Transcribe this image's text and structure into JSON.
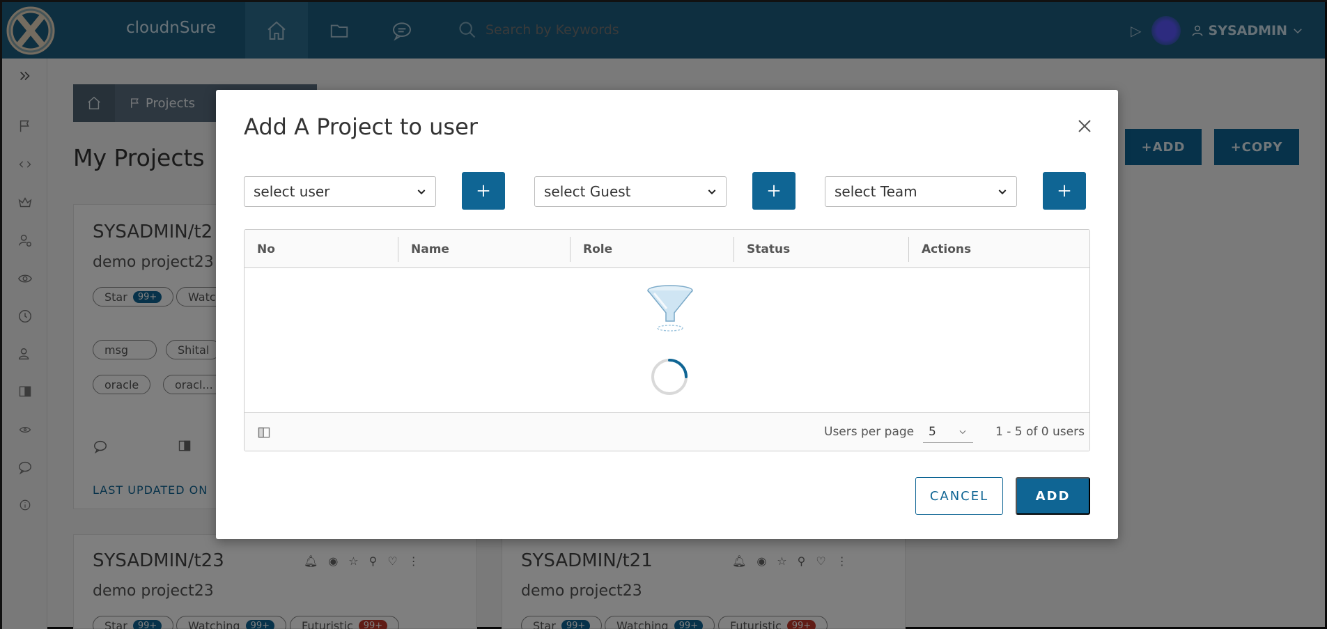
{
  "header": {
    "brand": "cloudnSure",
    "search_placeholder": "Search by Keywords",
    "user_label": "SYSADMIN",
    "icons": [
      "logo-icon",
      "home-icon",
      "folder-icon",
      "chat-icon",
      "search-icon",
      "play-icon",
      "user-icon",
      "chevron-down-icon"
    ]
  },
  "sidebar": {
    "icons": [
      "expand-icon",
      "flag-icon",
      "code-icon",
      "crown-icon",
      "user-settings-icon",
      "eye-icon",
      "clock-icon",
      "user-group-icon",
      "columns-icon",
      "eye-small-icon",
      "chat-icon",
      "info-icon"
    ]
  },
  "breadcrumb": {
    "label": "Projects"
  },
  "page": {
    "title": "My Projects",
    "add_label": "+ADD",
    "copy_label": "+COPY"
  },
  "cards": [
    {
      "title": "SYSADMIN/t2",
      "desc": "demo project23",
      "pills": [
        {
          "label": "Star",
          "count": "99+"
        },
        {
          "label": "Watc",
          "count": ""
        }
      ],
      "tags": [
        "msg",
        "Shital",
        "oracle",
        "oracl..."
      ],
      "last_updated": "LAST UPDATED ON"
    },
    {
      "title": "SYSADMIN/t23",
      "desc": "demo project23",
      "pills": [
        {
          "label": "Star",
          "count": "99+"
        },
        {
          "label": "Watching",
          "count": "99+"
        },
        {
          "label": "Futuristic",
          "count": "99+"
        }
      ]
    },
    {
      "title": "SYSADMIN/t21",
      "desc": "demo project23",
      "pills": [
        {
          "label": "Star",
          "count": "99+"
        },
        {
          "label": "Watching",
          "count": "99+"
        },
        {
          "label": "Futuristic",
          "count": "99+"
        }
      ]
    }
  ],
  "modal": {
    "title": "Add A Project to user",
    "selects": {
      "user": "select user",
      "guest": "select Guest",
      "team": "select Team"
    },
    "grid": {
      "columns": [
        "No",
        "Name",
        "Role",
        "Status",
        "Actions"
      ],
      "rows": [],
      "per_page_label": "Users per page",
      "per_page_value": "5",
      "pagination": "1 - 5 of 0 users"
    },
    "cancel_label": "CANCEL",
    "add_label": "ADD"
  },
  "colors": {
    "header_bg": "#1c5f80",
    "primary": "#0f6594",
    "overlay": "rgba(0,0,0,0.5)"
  }
}
